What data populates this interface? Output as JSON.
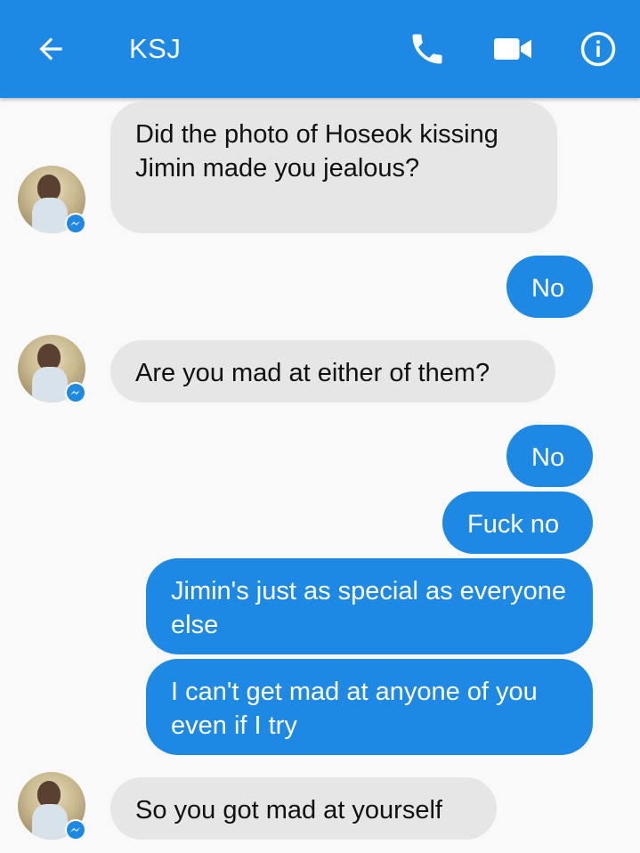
{
  "header": {
    "title": "KSJ",
    "icons": {
      "back": "arrow-left-icon",
      "call": "phone-icon",
      "video": "video-camera-icon",
      "info": "info-icon"
    },
    "bg_color": "#1e88e5"
  },
  "messages": [
    {
      "from": "them",
      "text": "Did the photo of Hoseok kissing Jimin made you jealous?"
    },
    {
      "from": "me",
      "text": "No"
    },
    {
      "from": "them",
      "text": "Are you mad at either of them?"
    },
    {
      "from": "me",
      "text": "No"
    },
    {
      "from": "me",
      "text": "Fuck no"
    },
    {
      "from": "me",
      "text": "Jimin's just as special as everyone else"
    },
    {
      "from": "me",
      "text": "I can't get mad at anyone of you even if I try"
    },
    {
      "from": "them",
      "text": "So you got mad at yourself"
    }
  ],
  "colors": {
    "outgoing": "#1e88e5",
    "incoming": "#e6e6e6"
  }
}
